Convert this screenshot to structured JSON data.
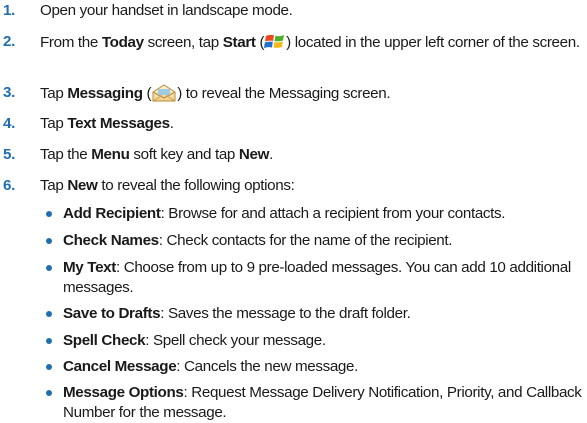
{
  "steps": [
    {
      "number": "1.",
      "text": "Open your handset in landscape mode."
    },
    {
      "number": "2.",
      "p1": "From the ",
      "b1": "Today",
      "p2": " screen, tap ",
      "b2": "Start",
      "p3": " (",
      "icon": "windows-start-icon",
      "p4": ") located in the upper left corner of the screen."
    },
    {
      "number": "3.",
      "p1": "Tap ",
      "b1": "Messaging",
      "p2": " (",
      "icon": "messaging-envelope-icon",
      "p3": ") to reveal the Messaging screen."
    },
    {
      "number": "4.",
      "p1": "Tap ",
      "b1": "Text Messages",
      "p2": "."
    },
    {
      "number": "5.",
      "p1": "Tap the ",
      "b1": "Menu",
      "p2": " soft key and tap ",
      "b2": "New",
      "p3": "."
    },
    {
      "number": "6.",
      "p1": "Tap ",
      "b1": "New",
      "p2": " to reveal the following options:"
    }
  ],
  "options": [
    {
      "term": "Add Recipient",
      "desc": ": Browse for and attach a recipient from your contacts."
    },
    {
      "term": "Check Names",
      "desc": ": Check contacts for the name of the recipient."
    },
    {
      "term": "My Text",
      "desc": ": Choose from up to 9 pre-loaded messages. You can add 10 additional messages."
    },
    {
      "term": "Save to Drafts",
      "desc": ": Saves the message to the draft folder."
    },
    {
      "term": "Spell Check",
      "desc": ": Spell check your message."
    },
    {
      "term": "Cancel Message",
      "desc": ": Cancels the new message."
    },
    {
      "term": "Message Options",
      "desc": ": Request Message Delivery Notification, Priority, and Callback Number for the message."
    }
  ],
  "colors": {
    "accent": "#1f6fb2",
    "text": "#1a1a1a"
  }
}
